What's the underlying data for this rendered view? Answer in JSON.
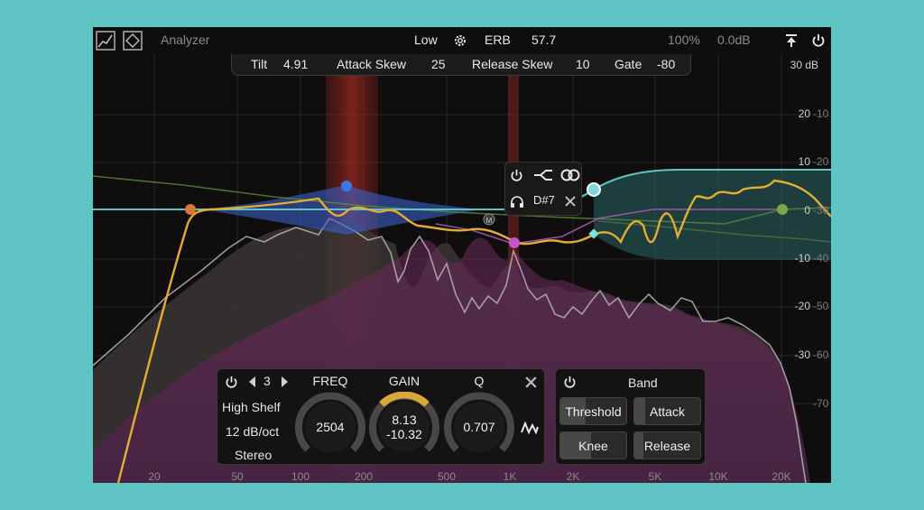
{
  "topbar": {
    "analyzer_label": "Analyzer",
    "mode_low": "Low",
    "scale_label": "ERB",
    "scale_value": "57.7",
    "zoom": "100%",
    "output_gain": "0.0dB"
  },
  "subbar": {
    "tilt_label": "Tilt",
    "tilt_value": "4.91",
    "attack_skew_label": "Attack Skew",
    "attack_skew_value": "25",
    "release_skew_label": "Release Skew",
    "release_skew_value": "10",
    "gate_label": "Gate",
    "gate_value": "-80"
  },
  "db_scale": {
    "left": [
      "30 dB",
      "20",
      "10",
      "0",
      "-10",
      "-20",
      "-30"
    ],
    "right": [
      "-10",
      "-20",
      "-30",
      "-40",
      "-50",
      "-60",
      "-70"
    ]
  },
  "freq_labels": [
    "20",
    "50",
    "100",
    "200",
    "500",
    "1K",
    "2K",
    "5K",
    "10K",
    "20K"
  ],
  "node_popup": {
    "note": "D#7",
    "icons": [
      "power-icon",
      "route-icon",
      "stereo-link-icon",
      "headphones-icon",
      "close-icon"
    ]
  },
  "band_panel": {
    "band_number": "3",
    "filter_type": "High Shelf",
    "slope": "12 dB/oct",
    "channel": "Stereo",
    "freq_label": "FREQ",
    "freq_value": "2504",
    "gain_label": "GAIN",
    "gain_value": "8.13",
    "gain_dynamic": "-10.32",
    "q_label": "Q",
    "q_value": "0.707"
  },
  "dynamics_panel": {
    "title": "Band",
    "threshold": "Threshold",
    "attack": "Attack",
    "knee": "Knee",
    "release": "Release"
  },
  "colors": {
    "accent_teal": "#5ec4c4",
    "curve_yellow": "#e3ad35",
    "band_blue": "#3a6fd6",
    "band_orange": "#d6763a",
    "band_pink": "#c655c9",
    "band_green": "#7aa64a",
    "solo_red": "#9b2a22"
  }
}
